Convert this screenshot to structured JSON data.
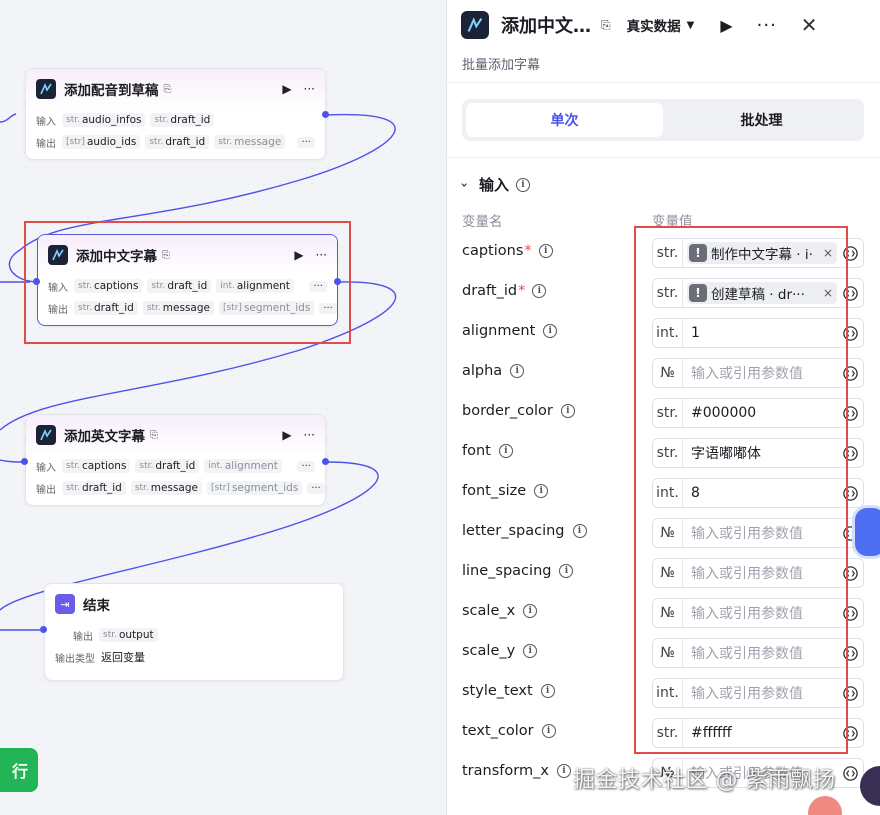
{
  "canvas": {
    "nodes": [
      {
        "title": "添加配音到草稿",
        "input_label": "输入",
        "inputs": [
          {
            "type": "str.",
            "name": "audio_infos"
          },
          {
            "type": "str.",
            "name": "draft_id"
          }
        ],
        "output_label": "输出",
        "outputs": [
          {
            "type": "[str]",
            "name": "audio_ids"
          },
          {
            "type": "str.",
            "name": "draft_id"
          },
          {
            "type": "str.",
            "name": "message"
          }
        ]
      },
      {
        "title": "添加中文字幕",
        "input_label": "输入",
        "inputs": [
          {
            "type": "str.",
            "name": "captions"
          },
          {
            "type": "str.",
            "name": "draft_id"
          },
          {
            "type": "int.",
            "name": "alignment"
          }
        ],
        "output_label": "输出",
        "outputs": [
          {
            "type": "str.",
            "name": "draft_id"
          },
          {
            "type": "str.",
            "name": "message"
          },
          {
            "type": "[str]",
            "name": "segment_ids"
          }
        ]
      },
      {
        "title": "添加英文字幕",
        "input_label": "输入",
        "inputs": [
          {
            "type": "str.",
            "name": "captions"
          },
          {
            "type": "str.",
            "name": "draft_id"
          },
          {
            "type": "int.",
            "name": "alignment"
          }
        ],
        "output_label": "输出",
        "outputs": [
          {
            "type": "str.",
            "name": "draft_id"
          },
          {
            "type": "str.",
            "name": "message"
          },
          {
            "type": "[str]",
            "name": "segment_ids"
          }
        ]
      }
    ],
    "end_node": {
      "title": "结束",
      "output_label": "输出",
      "output": {
        "type": "str.",
        "name": "output"
      },
      "output_type_label": "输出类型",
      "output_type_value": "返回变量"
    },
    "run_button": "行",
    "more_chip": "···"
  },
  "panel": {
    "title": "添加中文…",
    "data_mode": "真实数据",
    "description": "批量添加字幕",
    "tabs": [
      "单次",
      "批处理"
    ],
    "active_tab": "单次",
    "section_title": "输入",
    "col_name": "变量名",
    "col_value": "变量值",
    "params": [
      {
        "name": "captions",
        "required": "*",
        "type": "str.",
        "tag": "制作中文字幕 · i·"
      },
      {
        "name": "draft_id",
        "required": "*",
        "type": "str.",
        "tag": "创建草稿 · dr···"
      },
      {
        "name": "alignment",
        "required": "",
        "type": "int.",
        "value": "1"
      },
      {
        "name": "alpha",
        "required": "",
        "type": "№",
        "placeholder": "输入或引用参数值"
      },
      {
        "name": "border_color",
        "required": "",
        "type": "str.",
        "value": "#000000"
      },
      {
        "name": "font",
        "required": "",
        "type": "str.",
        "value": "字语嘟嘟体"
      },
      {
        "name": "font_size",
        "required": "",
        "type": "int.",
        "value": "8"
      },
      {
        "name": "letter_spacing",
        "required": "",
        "type": "№",
        "placeholder": "输入或引用参数值"
      },
      {
        "name": "line_spacing",
        "required": "",
        "type": "№",
        "placeholder": "输入或引用参数值"
      },
      {
        "name": "scale_x",
        "required": "",
        "type": "№",
        "placeholder": "输入或引用参数值"
      },
      {
        "name": "scale_y",
        "required": "",
        "type": "№",
        "placeholder": "输入或引用参数值"
      },
      {
        "name": "style_text",
        "required": "",
        "type": "int.",
        "placeholder": "输入或引用参数值"
      },
      {
        "name": "text_color",
        "required": "",
        "type": "str.",
        "value": "#ffffff"
      },
      {
        "name": "transform_x",
        "required": "",
        "type": "№",
        "placeholder": "输入或引用参数值"
      }
    ]
  },
  "watermark": "掘金技术社区 @ 紫雨飘扬",
  "colors": {
    "accent": "#4d53e8",
    "highlight": "#e24b4b",
    "run": "#22b455"
  }
}
